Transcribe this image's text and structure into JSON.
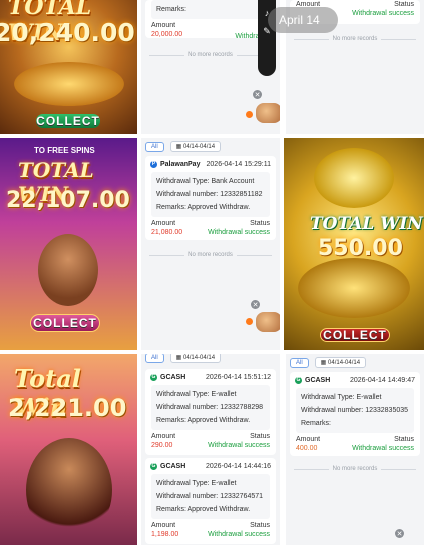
{
  "games": {
    "g1": {
      "title": "TOTAL WIN",
      "amount": "20,240.00",
      "button": "COLLECT"
    },
    "g2": {
      "subtitle": "TO FREE SPINS",
      "title": "TOTAL WIN",
      "amount": "22,107.00",
      "button": "COLLECT"
    },
    "g3": {
      "title": "TOTAL WIN",
      "amount": "550.00",
      "button": "COLLECT"
    },
    "g4": {
      "title": "Total Win",
      "amount": "2,221.00"
    }
  },
  "overlay": {
    "date_pill": "April 14"
  },
  "labels": {
    "remarks": "Remarks:",
    "amount": "Amount",
    "status": "Status",
    "withdrawal_type": "Withdrawal Type:",
    "withdrawal_number": "Withdrawal number:",
    "remarks_approved": "Remarks:   Approved Withdraw.",
    "no_more": "No more records",
    "all": "All",
    "date_filter": "04/14-04/14"
  },
  "records": {
    "p1": {
      "amount": "20,000.00",
      "status": "Withdrawal"
    },
    "p2": {
      "amount_label": "Amount",
      "status_label": "Status",
      "status": "Withdrawal success"
    },
    "p3": {
      "brand": "PalawanPay",
      "time": "2026-04-14 15:29:11",
      "type": "Bank Account",
      "number": "12332851182",
      "amount": "21,080.00",
      "status": "Withdrawal success"
    },
    "p4": [
      {
        "brand": "GCASH",
        "time": "2026-04-14 15:51:12",
        "type": "E-wallet",
        "number": "12332788298",
        "amount": "290.00",
        "status": "Withdrawal success"
      },
      {
        "brand": "GCASH",
        "time": "2026-04-14 14:44:16",
        "type": "E-wallet",
        "number": "12332764571",
        "amount": "1,198.00",
        "status": "Withdrawal success"
      }
    ],
    "p5": {
      "brand": "GCASH",
      "time": "2026-04-14 14:49:47",
      "type": "E-wallet",
      "number": "12332835035",
      "amount": "400.00",
      "status": "Withdrawal success"
    }
  }
}
